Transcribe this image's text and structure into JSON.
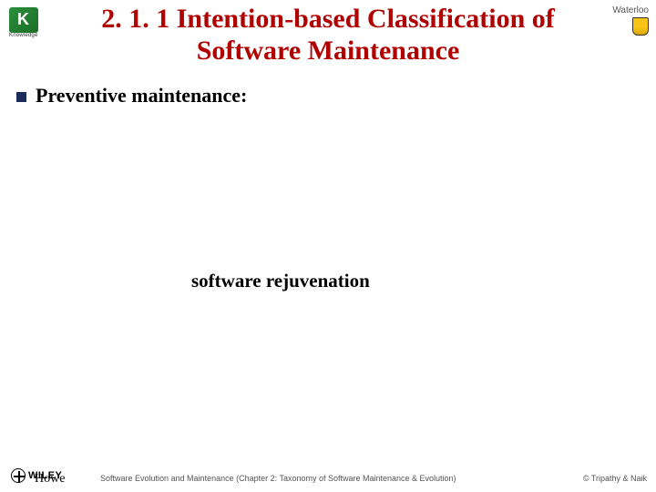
{
  "title_line1": "2. 1. 1 Intention-based Classification of",
  "title_line2": "Software Maintenance",
  "bullet_heading": "Preventive maintenance:",
  "mid_phrase": "software rejuvenation",
  "logo_left_label": "Knowledge",
  "logo_right_label": "Waterloo",
  "wiley_label": "WILEY",
  "howe_label": "Howe",
  "footer_center": "Software Evolution and Maintenance (Chapter 2: Taxonomy of Software Maintenance & Evolution)",
  "footer_right": "© Tripathy & Naik"
}
